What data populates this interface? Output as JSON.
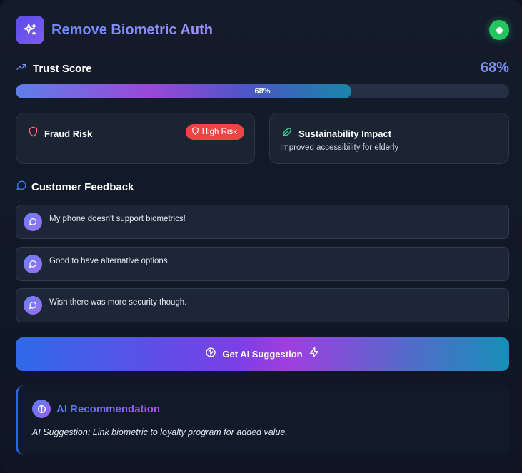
{
  "header": {
    "title": "Remove Biometric Auth",
    "status": "online"
  },
  "trust": {
    "label": "Trust Score",
    "value_text": "68%",
    "progress": 0.68,
    "bar_label": "68%"
  },
  "fraud": {
    "title": "Fraud Risk",
    "badge": "High Risk",
    "badge_color": "#ef4444"
  },
  "sustainability": {
    "title": "Sustainability Impact",
    "description": "Improved accessibility for elderly"
  },
  "feedback": {
    "title": "Customer Feedback",
    "items": [
      "My phone doesn't support biometrics!",
      "Good to have alternative options.",
      "Wish there was more security though."
    ]
  },
  "ai_button": {
    "label": "Get AI Suggestion"
  },
  "recommendation": {
    "title": "AI Recommendation",
    "text": "AI Suggestion: Link biometric to loyalty program for added value."
  },
  "icons": {
    "app": "sparkles-icon",
    "trust": "trending-up-icon",
    "fraud": "shield-icon",
    "sustainability": "leaf-icon",
    "feedback": "message-circle-icon",
    "ai_button_left": "brain-icon",
    "ai_button_right": "zap-icon"
  },
  "colors": {
    "accent": "#7b8ff5",
    "status": "#22c55e",
    "risk": "#ef4444",
    "leaf": "#34d399"
  }
}
